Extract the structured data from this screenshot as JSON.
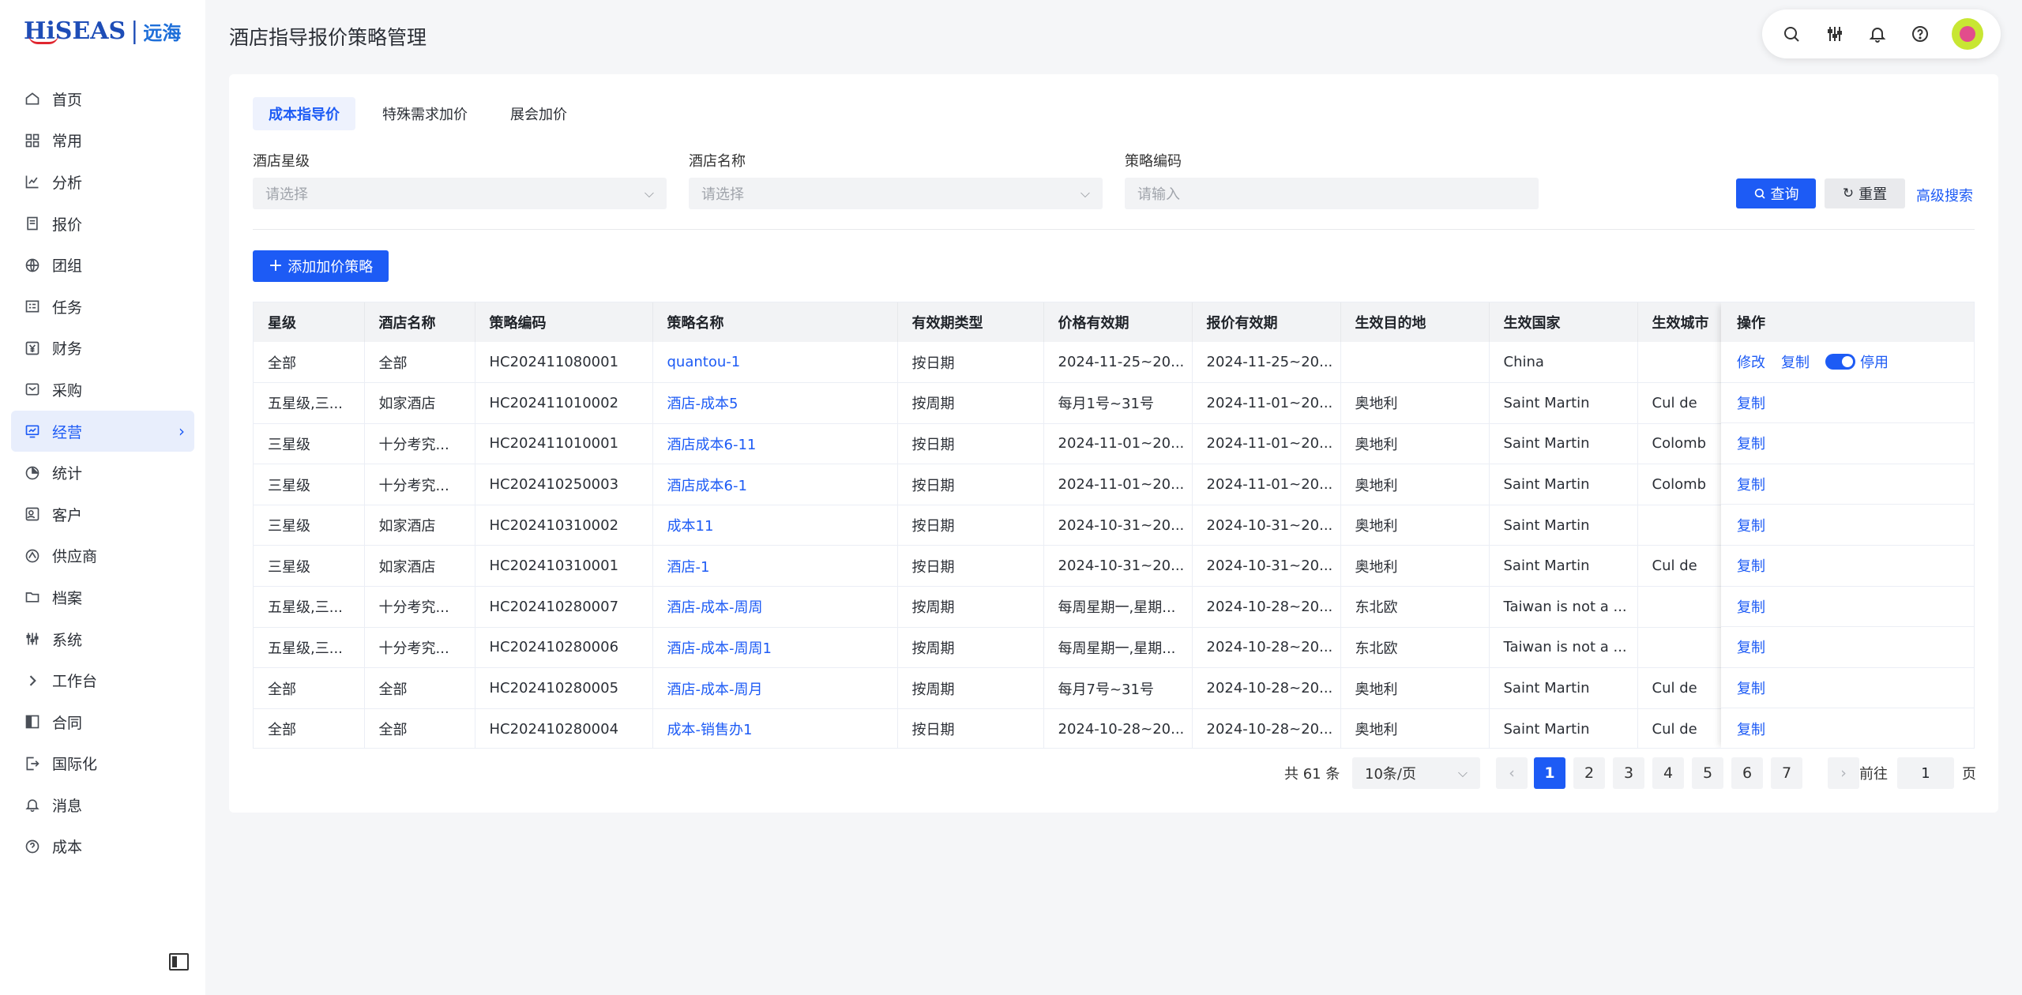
{
  "brand": {
    "name": "HiSEAS",
    "cn": "远海"
  },
  "page": {
    "title": "酒店指导报价策略管理"
  },
  "sidebar": {
    "items": [
      {
        "label": "首页",
        "icon": "home-icon"
      },
      {
        "label": "常用",
        "icon": "grid-icon"
      },
      {
        "label": "分析",
        "icon": "chart-icon"
      },
      {
        "label": "报价",
        "icon": "document-icon"
      },
      {
        "label": "团组",
        "icon": "globe-icon"
      },
      {
        "label": "任务",
        "icon": "task-icon"
      },
      {
        "label": "财务",
        "icon": "yen-icon"
      },
      {
        "label": "采购",
        "icon": "cart-icon"
      },
      {
        "label": "经营",
        "icon": "monitor-icon",
        "active": true
      },
      {
        "label": "统计",
        "icon": "pie-icon"
      },
      {
        "label": "客户",
        "icon": "contact-icon"
      },
      {
        "label": "供应商",
        "icon": "supplier-icon"
      },
      {
        "label": "档案",
        "icon": "folder-icon"
      },
      {
        "label": "系统",
        "icon": "sliders-icon"
      },
      {
        "label": "工作台",
        "icon": "chevron-right-icon"
      },
      {
        "label": "合同",
        "icon": "contract-icon"
      },
      {
        "label": "国际化",
        "icon": "exit-icon"
      },
      {
        "label": "消息",
        "icon": "bell-icon"
      },
      {
        "label": "成本",
        "icon": "help-icon"
      }
    ]
  },
  "tabs": [
    {
      "label": "成本指导价",
      "active": true
    },
    {
      "label": "特殊需求加价"
    },
    {
      "label": "展会加价"
    }
  ],
  "filters": {
    "star": {
      "label": "酒店星级",
      "placeholder": "请选择"
    },
    "hotel": {
      "label": "酒店名称",
      "placeholder": "请选择"
    },
    "code": {
      "label": "策略编码",
      "placeholder": "请输入"
    },
    "query_label": "查询",
    "reset_label": "重置",
    "advanced_label": "高级搜索"
  },
  "add_button_label": "添加加价策略",
  "table": {
    "columns": [
      "星级",
      "酒店名称",
      "策略编码",
      "策略名称",
      "有效期类型",
      "价格有效期",
      "报价有效期",
      "生效目的地",
      "生效国家",
      "生效城市"
    ],
    "ops_header": "操作",
    "rows": [
      {
        "star": "全部",
        "hotel": "全部",
        "code": "HC202411080001",
        "name": "quantou-1",
        "type": "按日期",
        "price": "2024-11-25~20...",
        "quote": "2024-11-25~20...",
        "dest": "",
        "country": "China",
        "city": "",
        "ops": [
          "修改",
          "复制",
          "停用"
        ]
      },
      {
        "star": "五星级,三...",
        "hotel": "如家酒店",
        "code": "HC202411010002",
        "name": "酒店-成本5",
        "type": "按周期",
        "price": "每月1号~31号",
        "quote": "2024-11-01~20...",
        "dest": "奥地利",
        "country": "Saint Martin",
        "city": "Cul de",
        "ops": [
          "复制"
        ]
      },
      {
        "star": "三星级",
        "hotel": "十分考究...",
        "code": "HC202411010001",
        "name": "酒店成本6-11",
        "type": "按日期",
        "price": "2024-11-01~20...",
        "quote": "2024-11-01~20...",
        "dest": "奥地利",
        "country": "Saint Martin",
        "city": "Colomb",
        "ops": [
          "复制"
        ]
      },
      {
        "star": "三星级",
        "hotel": "十分考究...",
        "code": "HC202410250003",
        "name": "酒店成本6-1",
        "type": "按日期",
        "price": "2024-11-01~20...",
        "quote": "2024-11-01~20...",
        "dest": "奥地利",
        "country": "Saint Martin",
        "city": "Colomb",
        "ops": [
          "复制"
        ]
      },
      {
        "star": "三星级",
        "hotel": "如家酒店",
        "code": "HC202410310002",
        "name": "成本11",
        "type": "按日期",
        "price": "2024-10-31~20...",
        "quote": "2024-10-31~20...",
        "dest": "奥地利",
        "country": "Saint Martin",
        "city": "",
        "ops": [
          "复制"
        ]
      },
      {
        "star": "三星级",
        "hotel": "如家酒店",
        "code": "HC202410310001",
        "name": "酒店-1",
        "type": "按日期",
        "price": "2024-10-31~20...",
        "quote": "2024-10-31~20...",
        "dest": "奥地利",
        "country": "Saint Martin",
        "city": "Cul de",
        "ops": [
          "复制"
        ]
      },
      {
        "star": "五星级,三...",
        "hotel": "十分考究...",
        "code": "HC202410280007",
        "name": "酒店-成本-周周",
        "type": "按周期",
        "price": "每周星期一,星期...",
        "quote": "2024-10-28~20...",
        "dest": "东北欧",
        "country": "Taiwan is not a ...",
        "city": "",
        "ops": [
          "复制"
        ]
      },
      {
        "star": "五星级,三...",
        "hotel": "十分考究...",
        "code": "HC202410280006",
        "name": "酒店-成本-周周1",
        "type": "按周期",
        "price": "每周星期一,星期...",
        "quote": "2024-10-28~20...",
        "dest": "东北欧",
        "country": "Taiwan is not a ...",
        "city": "",
        "ops": [
          "复制"
        ]
      },
      {
        "star": "全部",
        "hotel": "全部",
        "code": "HC202410280005",
        "name": "酒店-成本-周月",
        "type": "按周期",
        "price": "每月7号~31号",
        "quote": "2024-10-28~20...",
        "dest": "奥地利",
        "country": "Saint Martin",
        "city": "Cul de",
        "ops": [
          "复制"
        ]
      },
      {
        "star": "全部",
        "hotel": "全部",
        "code": "HC202410280004",
        "name": "成本-销售办1",
        "type": "按日期",
        "price": "2024-10-28~20...",
        "quote": "2024-10-28~20...",
        "dest": "奥地利",
        "country": "Saint Martin",
        "city": "Cul de",
        "ops": [
          "复制"
        ]
      }
    ]
  },
  "pagination": {
    "total_label": "共 61 条",
    "page_size": "10条/页",
    "pages": [
      "1",
      "2",
      "3",
      "4",
      "5",
      "6",
      "7"
    ],
    "current": "1",
    "goto_label": "前往",
    "goto_value": "1",
    "unit_label": "页"
  },
  "colors": {
    "primary": "#1d5bf5",
    "active_nav_bg": "#e8eefc",
    "table_header_bg": "#f2f3f5"
  }
}
